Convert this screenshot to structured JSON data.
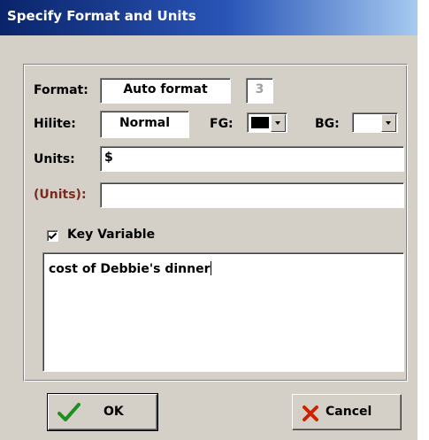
{
  "window": {
    "title": "Specify Format and Units"
  },
  "format": {
    "label": "Format:",
    "value": "Auto format",
    "digits": "3"
  },
  "hilite": {
    "label": "Hilite:",
    "value": "Normal",
    "fg_label": "FG:",
    "fg_color": "#000000",
    "bg_label": "BG:",
    "bg_color": "#ffffff"
  },
  "units": {
    "label": "Units:",
    "value": "$"
  },
  "units_alt": {
    "label": "(Units):",
    "value": ""
  },
  "key_variable": {
    "label": "Key Variable",
    "checked": true
  },
  "description": {
    "text": "cost of Debbie's dinner"
  },
  "buttons": {
    "ok_label": "OK",
    "cancel_label": "Cancel"
  },
  "colors": {
    "title_bar": "#0a246a",
    "dialog_bg": "#d4d0c8",
    "ok_check": "#1f8f1f",
    "cancel_x": "#cc2200",
    "units_alt_label": "#7a2a1e"
  }
}
